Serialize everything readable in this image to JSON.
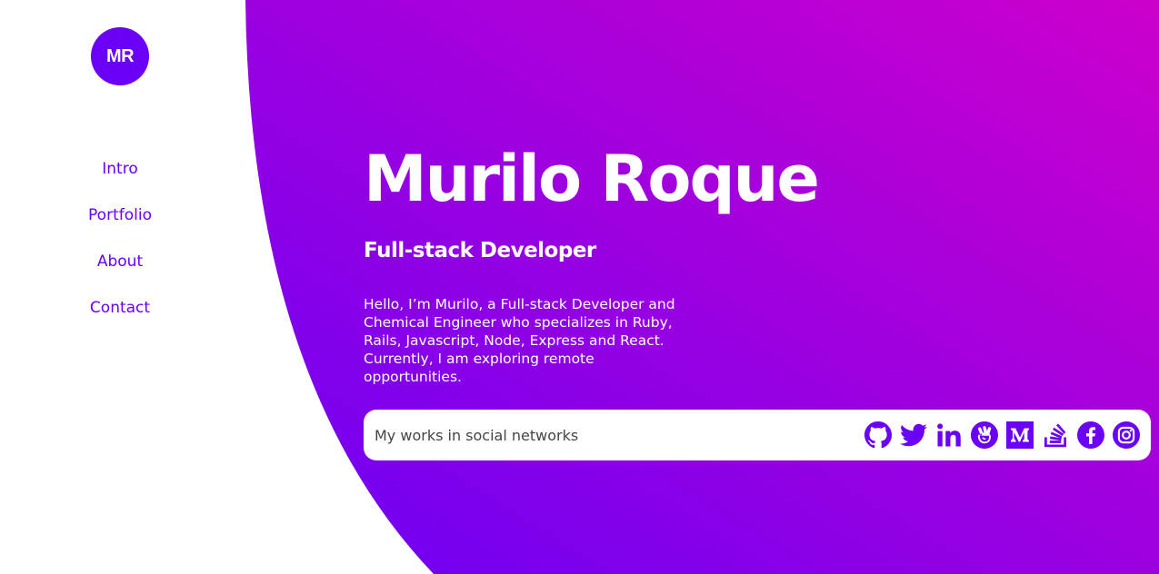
{
  "logo": {
    "initials": "MR"
  },
  "nav": {
    "items": [
      {
        "label": "Intro"
      },
      {
        "label": "Portfolio"
      },
      {
        "label": "About"
      },
      {
        "label": "Contact"
      }
    ]
  },
  "hero": {
    "name": "Murilo Roque",
    "role": "Full-stack Developer",
    "bio": "Hello, I’m Murilo, a Full-stack Developer and Chemical Engineer who specializes in Ruby, Rails, Javascript, Node, Express and React. Currently, I am exploring remote opportunities."
  },
  "social": {
    "label": "My works in social networks",
    "icons": [
      "github-icon",
      "twitter-icon",
      "linkedin-icon",
      "angellist-icon",
      "medium-icon",
      "stackoverflow-icon",
      "facebook-icon",
      "instagram-icon"
    ]
  },
  "colors": {
    "brand": "#6a00f4",
    "gradient_start": "#6a00f4",
    "gradient_end": "#cc00cc",
    "background": "#ffffff"
  }
}
